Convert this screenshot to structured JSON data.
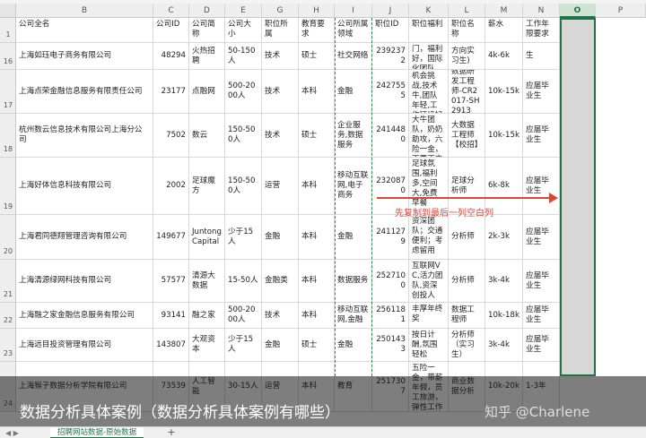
{
  "columns": [
    "B",
    "C",
    "D",
    "E",
    "G",
    "H",
    "I",
    "J",
    "K",
    "L",
    "M",
    "N",
    "O",
    "P"
  ],
  "header": {
    "company": "公司全名",
    "company_id": "公司ID",
    "short_name": "公司简称",
    "size": "公司大小",
    "domain": "职位所属",
    "edu": "教育要求",
    "industry": "公司所属领域",
    "job_id": "职位ID",
    "welfare": "职位福利",
    "job_name": "职位名称",
    "salary": "薪水",
    "years": "工作年限要求"
  },
  "rows": [
    {
      "num": "16",
      "company": "上海如珏电子商务有限公司",
      "company_id": "48294",
      "short_name": "火热招聘",
      "size": "50-150人",
      "domain": "技术",
      "edu": "硕士",
      "industry": "社交网络",
      "job_id": "2392372",
      "welfare": "门，福利好，国际化团队，人性化环境",
      "job_name": "方向实习生)",
      "salary": "4k-6k",
      "years": "生"
    },
    {
      "num": "17",
      "company": "上海点荣金融信息服务有限责任公司",
      "company_id": "23177",
      "short_name": "点融网",
      "size": "500-2000人",
      "domain": "技术",
      "edu": "本科",
      "industry": "金融",
      "job_id": "2427555",
      "welfare": "机会挑战,技术牛,团队年轻,工作环境好",
      "job_name": "数据研发工程师-CR2017-SH2913",
      "salary": "10k-15k",
      "years": "应届毕业生"
    },
    {
      "num": "18",
      "company": "杭州数云信息技术有限公司上海分公司",
      "company_id": "7502",
      "short_name": "数云",
      "size": "150-500人",
      "domain": "技术",
      "edu": "硕士",
      "industry": "企业服务,数据服务",
      "job_id": "2414480",
      "welfare": "大牛团队，奶奶助攻，六险一金，不要不来",
      "job_name": "大数据工程师【校招】",
      "salary": "10k-15k",
      "years": "应届毕业生"
    },
    {
      "num": "19",
      "company": "上海好体信息科技有限公司",
      "company_id": "2002",
      "short_name": "足球魔方",
      "size": "150-500人",
      "domain": "运营",
      "edu": "本科",
      "industry": "移动互联网,电子商务",
      "job_id": "2320870",
      "welfare": "足球氛围,福利多,空间大,免费早餐",
      "job_name": "足球分析师",
      "salary": "6k-8k",
      "years": "应届毕业生"
    },
    {
      "num": "20",
      "company": "上海君同德翔管理咨询有限公司",
      "company_id": "149677",
      "short_name": "Juntong Capital",
      "size": "少于15人",
      "domain": "金融",
      "edu": "本科",
      "industry": "金融",
      "job_id": "2411279",
      "welfare": "资深团队；交通便利；考虑留用",
      "job_name": "分析师",
      "salary": "2k-3k",
      "years": "应届毕业生"
    },
    {
      "num": "21",
      "company": "上海清源绿网科技有限公司",
      "company_id": "57577",
      "short_name": "清源大数据",
      "size": "15-50人",
      "domain": "金融类",
      "edu": "本科",
      "industry": "数据服务",
      "job_id": "2527100",
      "welfare": "互联网VC,活力团队,资深创投人",
      "job_name": "分析师",
      "salary": "3k-4k",
      "years": "应届毕业生"
    },
    {
      "num": "22",
      "company": "上海融之家金融信息服务有限公司",
      "company_id": "93141",
      "short_name": "融之家",
      "size": "500-2000人",
      "domain": "技术",
      "edu": "本科",
      "industry": "移动互联网,金融",
      "job_id": "2561181",
      "welfare": "丰厚年终奖",
      "job_name": "数据工程师",
      "salary": "10k-18k",
      "years": "应届毕业生"
    },
    {
      "num": "23",
      "company": "上海远目投资管理有限公司",
      "company_id": "143807",
      "short_name": "大观资本",
      "size": "少于15人",
      "domain": "金融",
      "edu": "硕士",
      "industry": "金融",
      "job_id": "2501433",
      "welfare": "按日计酬,氛围轻松",
      "job_name": "分析师（实习生）",
      "salary": "3k-4k",
      "years": "应届毕业生"
    },
    {
      "num": "24",
      "company": "上海猴子数据分析学院有限公司",
      "company_id": "73539",
      "short_name": "人工智能",
      "size": "30-15人",
      "domain": "运营",
      "edu": "本科",
      "industry": "教育",
      "job_id": "2517307",
      "welfare": "五险一金，带薪年假，员工旅游，弹性工作日",
      "job_name": "商业数据分析",
      "salary": "10k-20k",
      "years": "1-3年"
    }
  ],
  "annotation": "先复制到最后一列空白列",
  "overlay_title": "数据分析具体案例（数据分析具体案例有哪些）",
  "watermark": "知乎 @Charlene",
  "sheet_tab": "招聘网站数据-原始数据",
  "add_tab": "+"
}
